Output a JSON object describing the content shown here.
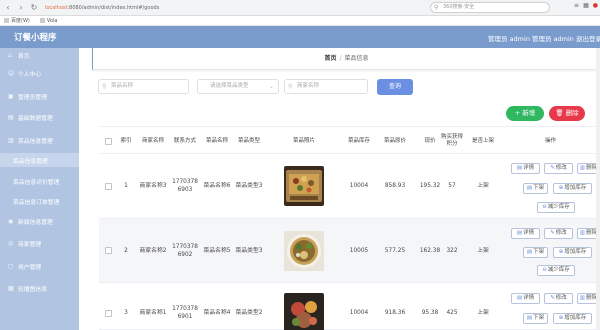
{
  "browser": {
    "url_host": "localhost",
    "url_rest": ":8080/admin/dist/index.html#/goods",
    "search_placeholder": "360搜索·安全",
    "bookmarks": [
      "百度(W)",
      "Vola"
    ]
  },
  "header": {
    "title": "订餐小程序",
    "user_info": "管理员 admin   管理员 admin   退出登录"
  },
  "sidebar": {
    "items": [
      {
        "label": "首页",
        "icon": "home-icon"
      },
      {
        "label": "个人中心",
        "icon": "user-icon"
      },
      {
        "label": "管理员管理",
        "icon": "admin-icon"
      },
      {
        "label": "基础数据管理",
        "icon": "data-icon"
      },
      {
        "label": "菜品信息管理",
        "icon": "dish-icon"
      },
      {
        "label": "菜品信息管理",
        "icon": ""
      },
      {
        "label": "菜品信息评价管理",
        "icon": ""
      },
      {
        "label": "菜品信息订单管理",
        "icon": ""
      },
      {
        "label": "新闻信息管理",
        "icon": "news-icon"
      },
      {
        "label": "商家管理",
        "icon": "shop-icon"
      },
      {
        "label": "用户管理",
        "icon": "users-icon"
      },
      {
        "label": "轮播图信息",
        "icon": "carousel-icon"
      }
    ]
  },
  "breadcrumb": {
    "home": "首页",
    "current": "菜品信息"
  },
  "search": {
    "name_placeholder": "菜品名称",
    "type_placeholder": "请选择菜品类型",
    "merchant_placeholder": "商家名称",
    "query_label": "查询"
  },
  "actions": {
    "add_label": "+ 新增",
    "delete_label": "删除"
  },
  "table": {
    "columns": [
      "索引",
      "商家名称",
      "联系方式",
      "菜品名称",
      "菜品类型",
      "菜品照片",
      "菜品库存",
      "菜品原价",
      "现价",
      "购买获得积分",
      "是否上架",
      "操作"
    ],
    "rows": [
      {
        "index": "1",
        "merchant": "商家名称3",
        "phone": "17703786903",
        "dish": "菜品名称6",
        "type": "菜品类型3",
        "stock": "10004",
        "orig_price": "858.93",
        "price": "195.32",
        "points": "57",
        "shelf": "上架"
      },
      {
        "index": "2",
        "merchant": "商家名称2",
        "phone": "17703786902",
        "dish": "菜品名称5",
        "type": "菜品类型3",
        "stock": "10005",
        "orig_price": "577.25",
        "price": "162.38",
        "points": "322",
        "shelf": "上架"
      },
      {
        "index": "3",
        "merchant": "商家名称1",
        "phone": "17703786901",
        "dish": "菜品名称4",
        "type": "菜品类型2",
        "stock": "10004",
        "orig_price": "918.36",
        "price": "95.38",
        "points": "425",
        "shelf": "上架"
      }
    ],
    "op_labels": {
      "detail": "详情",
      "edit": "修改",
      "delete": "删除",
      "offshelf": "下架",
      "add_stock": "增加库存",
      "reduce_stock": "减少库存"
    }
  },
  "colors": {
    "header": "#7a9ccd",
    "sidebar": "#b1c5e3",
    "primary": "#6b8fe3",
    "success": "#2fb860",
    "danger": "#e8394a"
  }
}
